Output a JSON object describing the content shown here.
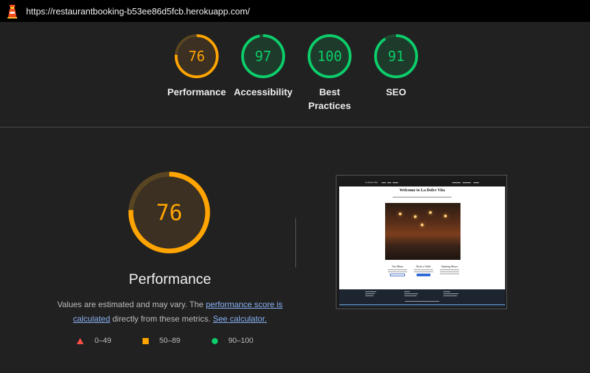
{
  "header": {
    "url": "https://restaurantbooking-b53ee86d5fcb.herokuapp.com/",
    "logo_icon": "lighthouse-icon"
  },
  "colors": {
    "fail": "#ff4e42",
    "average": "#ffa400",
    "pass": "#0cce6b"
  },
  "gauges": [
    {
      "label": "Performance",
      "score": "76",
      "fraction": 0.76,
      "rating": "average"
    },
    {
      "label": "Accessibility",
      "score": "97",
      "fraction": 0.97,
      "rating": "pass"
    },
    {
      "label": "Best Practices",
      "score": "100",
      "fraction": 1.0,
      "rating": "pass"
    },
    {
      "label": "SEO",
      "score": "91",
      "fraction": 0.91,
      "rating": "pass"
    }
  ],
  "performance_section": {
    "score": "76",
    "fraction": 0.76,
    "title": "Performance",
    "description_prefix": "Values are estimated and may vary. The ",
    "score_link": "performance score is calculated",
    "description_middle": " directly from these metrics. ",
    "calculator_link": "See calculator."
  },
  "legend": [
    {
      "range": "0–49",
      "shape": "triangle",
      "rating": "fail"
    },
    {
      "range": "50–89",
      "shape": "square",
      "rating": "average"
    },
    {
      "range": "90–100",
      "shape": "circle",
      "rating": "pass"
    }
  ],
  "screenshot": {
    "nav_brand": "La Dolce Vita",
    "heading": "Welcome to La Dolce Vita",
    "columns": [
      "Our Menu",
      "Book a Table",
      "Opening Hours"
    ]
  }
}
